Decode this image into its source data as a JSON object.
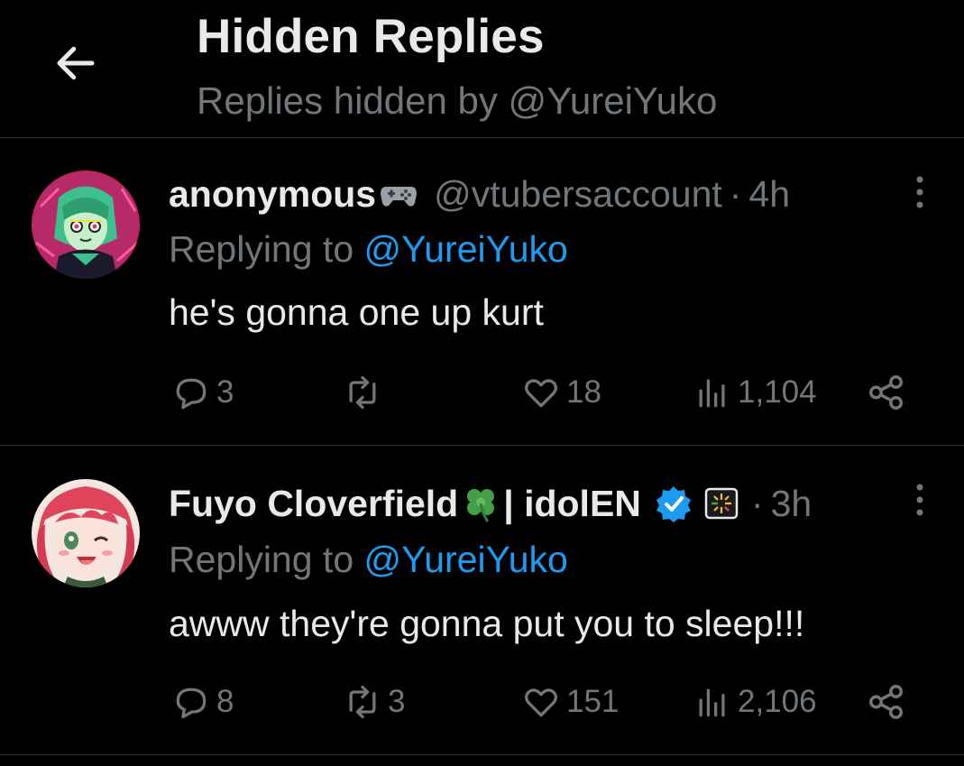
{
  "header": {
    "title": "Hidden Replies",
    "subtitle": "Replies hidden by @YureiYuko"
  },
  "replies": [
    {
      "display_name": "anonymous",
      "name_emoji": "game-controller",
      "handle": "@vtubersaccount",
      "separator": "·",
      "time": "4h",
      "replying_prefix": "Replying to",
      "replying_to": "@YureiYuko",
      "text": "he's gonna one up kurt",
      "stats": {
        "replies": "3",
        "retweets": "",
        "likes": "18",
        "views": "1,104"
      },
      "verified": false
    },
    {
      "display_name": "Fuyo Cloverfield",
      "name_emoji": "four-leaf-clover",
      "name_suffix": "| idolEN",
      "handle": "",
      "separator": "·",
      "time": "3h",
      "replying_prefix": "Replying to",
      "replying_to": "@YureiYuko",
      "text": "awww they're gonna put you to sleep!!!",
      "stats": {
        "replies": "8",
        "retweets": "3",
        "likes": "151",
        "views": "2,106"
      },
      "verified": true
    }
  ],
  "colors": {
    "background": "#000000",
    "primary_text": "#e7e9ea",
    "secondary_text": "#71767b",
    "accent": "#1d9bf0",
    "divider": "#2f3336"
  },
  "icons": {
    "back": "arrow-left-icon",
    "more": "more-vertical-icon",
    "reply": "reply-bubble-icon",
    "retweet": "retweet-icon",
    "like": "heart-icon",
    "views": "views-bar-icon",
    "share": "share-icon",
    "verified": "verified-badge-icon",
    "affiliate": "affiliate-badge-icon"
  }
}
